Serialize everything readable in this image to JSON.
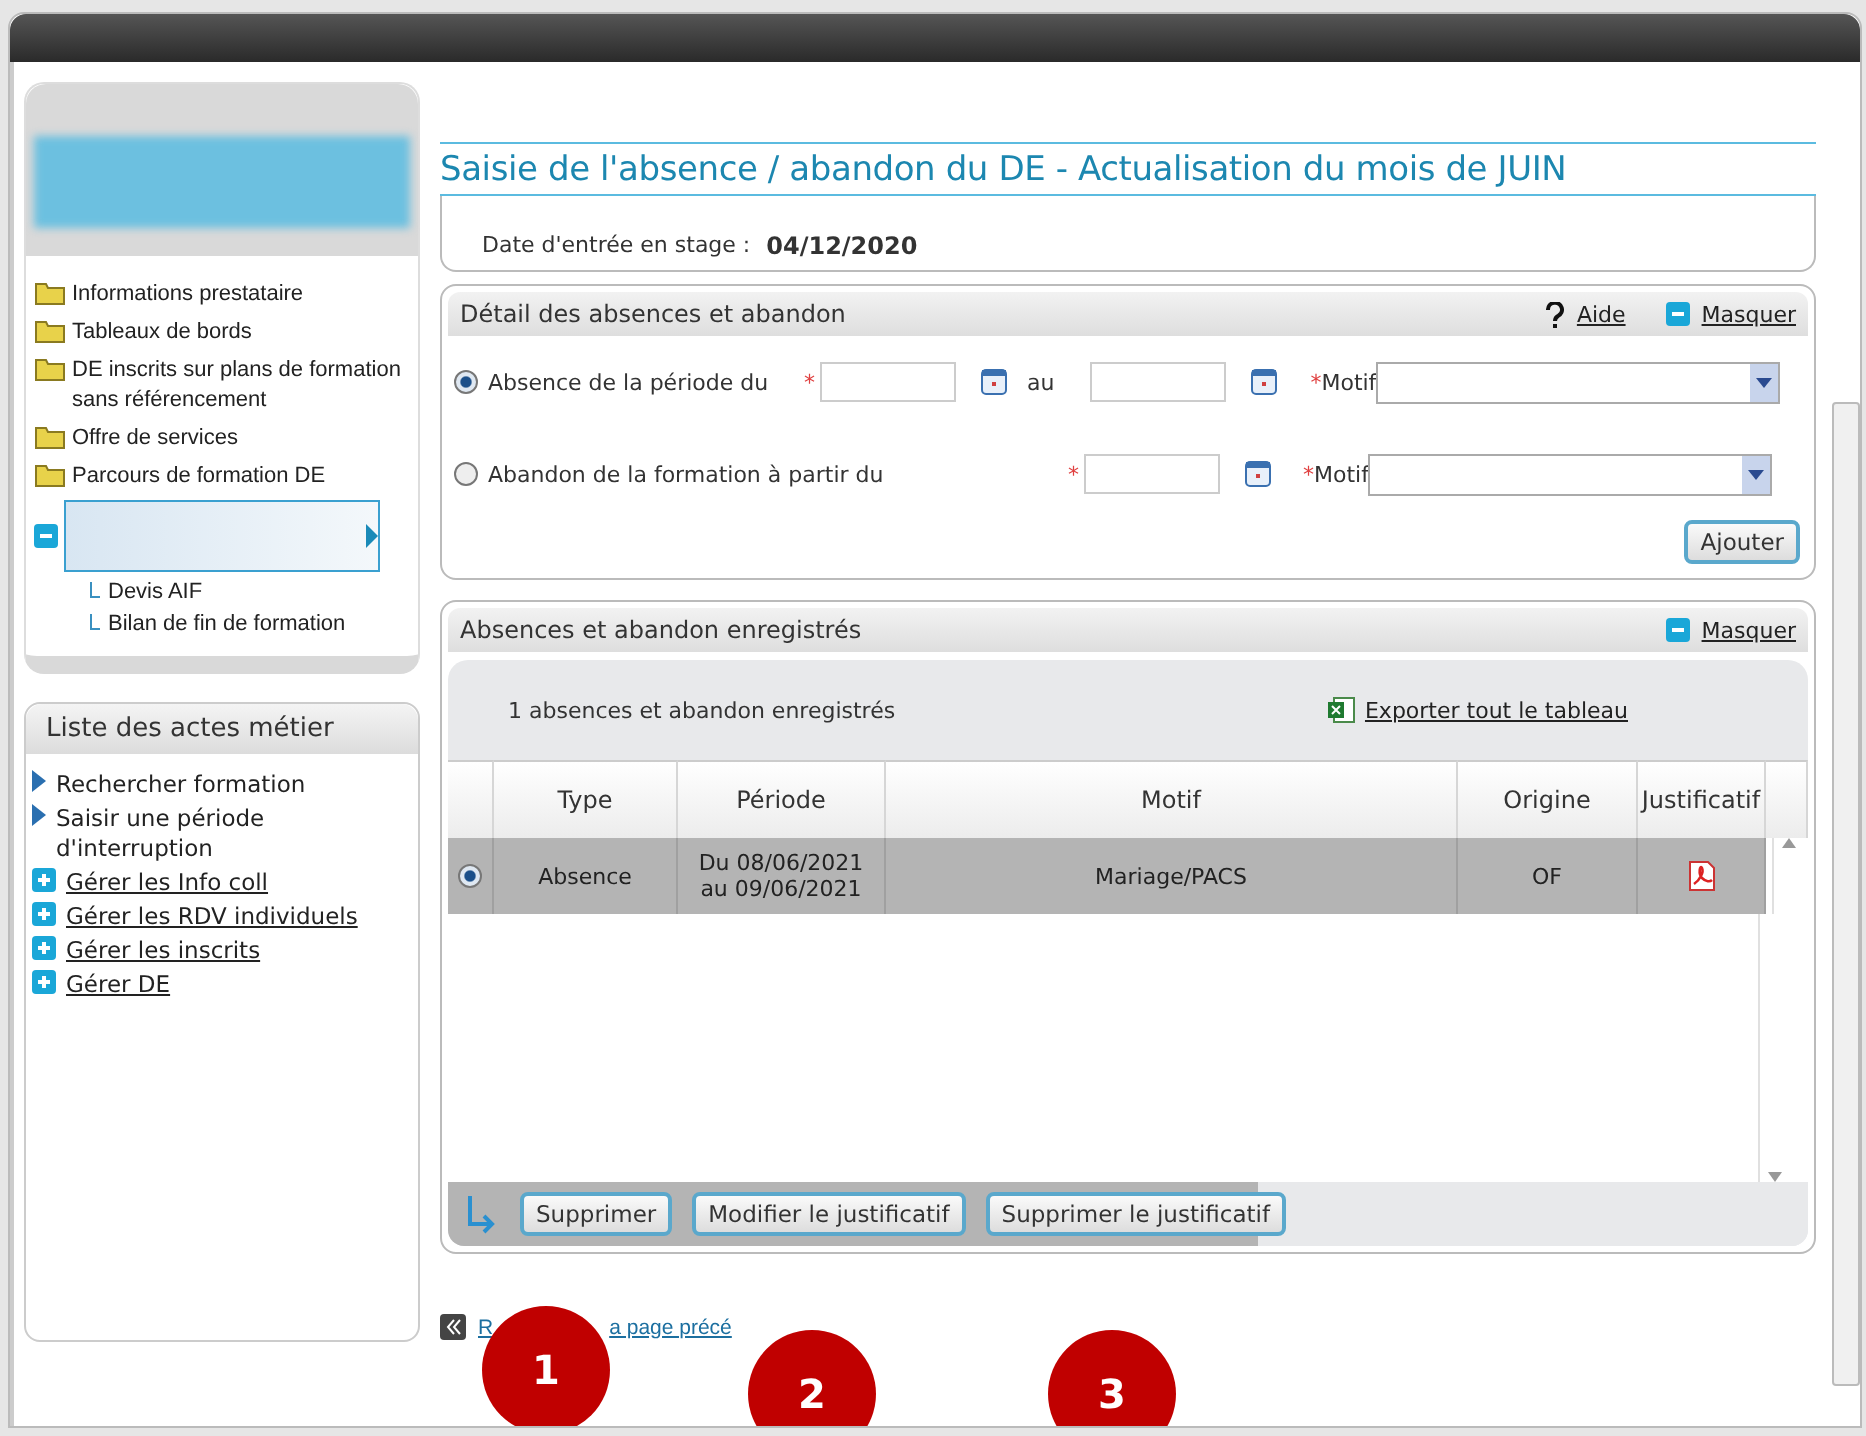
{
  "page_title": "Saisie de l'absence / abandon du DE - Actualisation du mois de JUIN",
  "sidebar": {
    "tree": [
      {
        "label": "Informations prestataire"
      },
      {
        "label": "Tableaux de bords"
      },
      {
        "label": "DE inscrits sur plans de formation sans référencement"
      },
      {
        "label": "Offre de services"
      },
      {
        "label": "Parcours de formation DE",
        "expanded": true,
        "children": [
          {
            "label": "Devis AIF"
          },
          {
            "label": "Bilan de fin de formation"
          }
        ]
      }
    ],
    "actions_title": "Liste des actes métier",
    "actions": [
      {
        "kind": "arrow",
        "label": "Rechercher formation"
      },
      {
        "kind": "arrow",
        "label": "Saisir une période d'interruption"
      },
      {
        "kind": "plus",
        "label": "Gérer les Info coll"
      },
      {
        "kind": "plus",
        "label": "Gérer les RDV individuels"
      },
      {
        "kind": "plus",
        "label": "Gérer les inscrits"
      },
      {
        "kind": "plus",
        "label": "Gérer DE"
      }
    ]
  },
  "stage": {
    "label": "Date d'entrée en stage :",
    "value": "04/12/2020"
  },
  "detail": {
    "title": "Détail des absences et abandon",
    "help": "Aide",
    "hide": "Masquer",
    "options": [
      {
        "kind": "period",
        "label": "Absence de la période du",
        "selected": true,
        "required": "*",
        "between": "au",
        "motif_label": "Motif"
      },
      {
        "kind": "from",
        "label": "Abandon de la formation à partir du",
        "selected": false,
        "required": "*",
        "motif_label": "Motif"
      }
    ],
    "add_button": "Ajouter"
  },
  "records": {
    "title": "Absences et abandon enregistrés",
    "hide": "Masquer",
    "count": "1 absences et abandon enregistrés",
    "export": "Exporter tout le tableau",
    "columns": [
      "Type",
      "Période",
      "Motif",
      "Origine",
      "Justificatif"
    ],
    "rows": [
      {
        "selected": true,
        "type": "Absence",
        "period": [
          "Du 08/06/2021",
          "au 09/06/2021"
        ],
        "motif": "Mariage/PACS",
        "origin": "OF",
        "has_attachment": true
      }
    ],
    "buttons": [
      "Supprimer",
      "Modifier le justificatif",
      "Supprimer le justificatif"
    ]
  },
  "back_link": {
    "parts": [
      "R",
      "a page précé"
    ]
  },
  "annotations": [
    "1",
    "2",
    "3"
  ]
}
